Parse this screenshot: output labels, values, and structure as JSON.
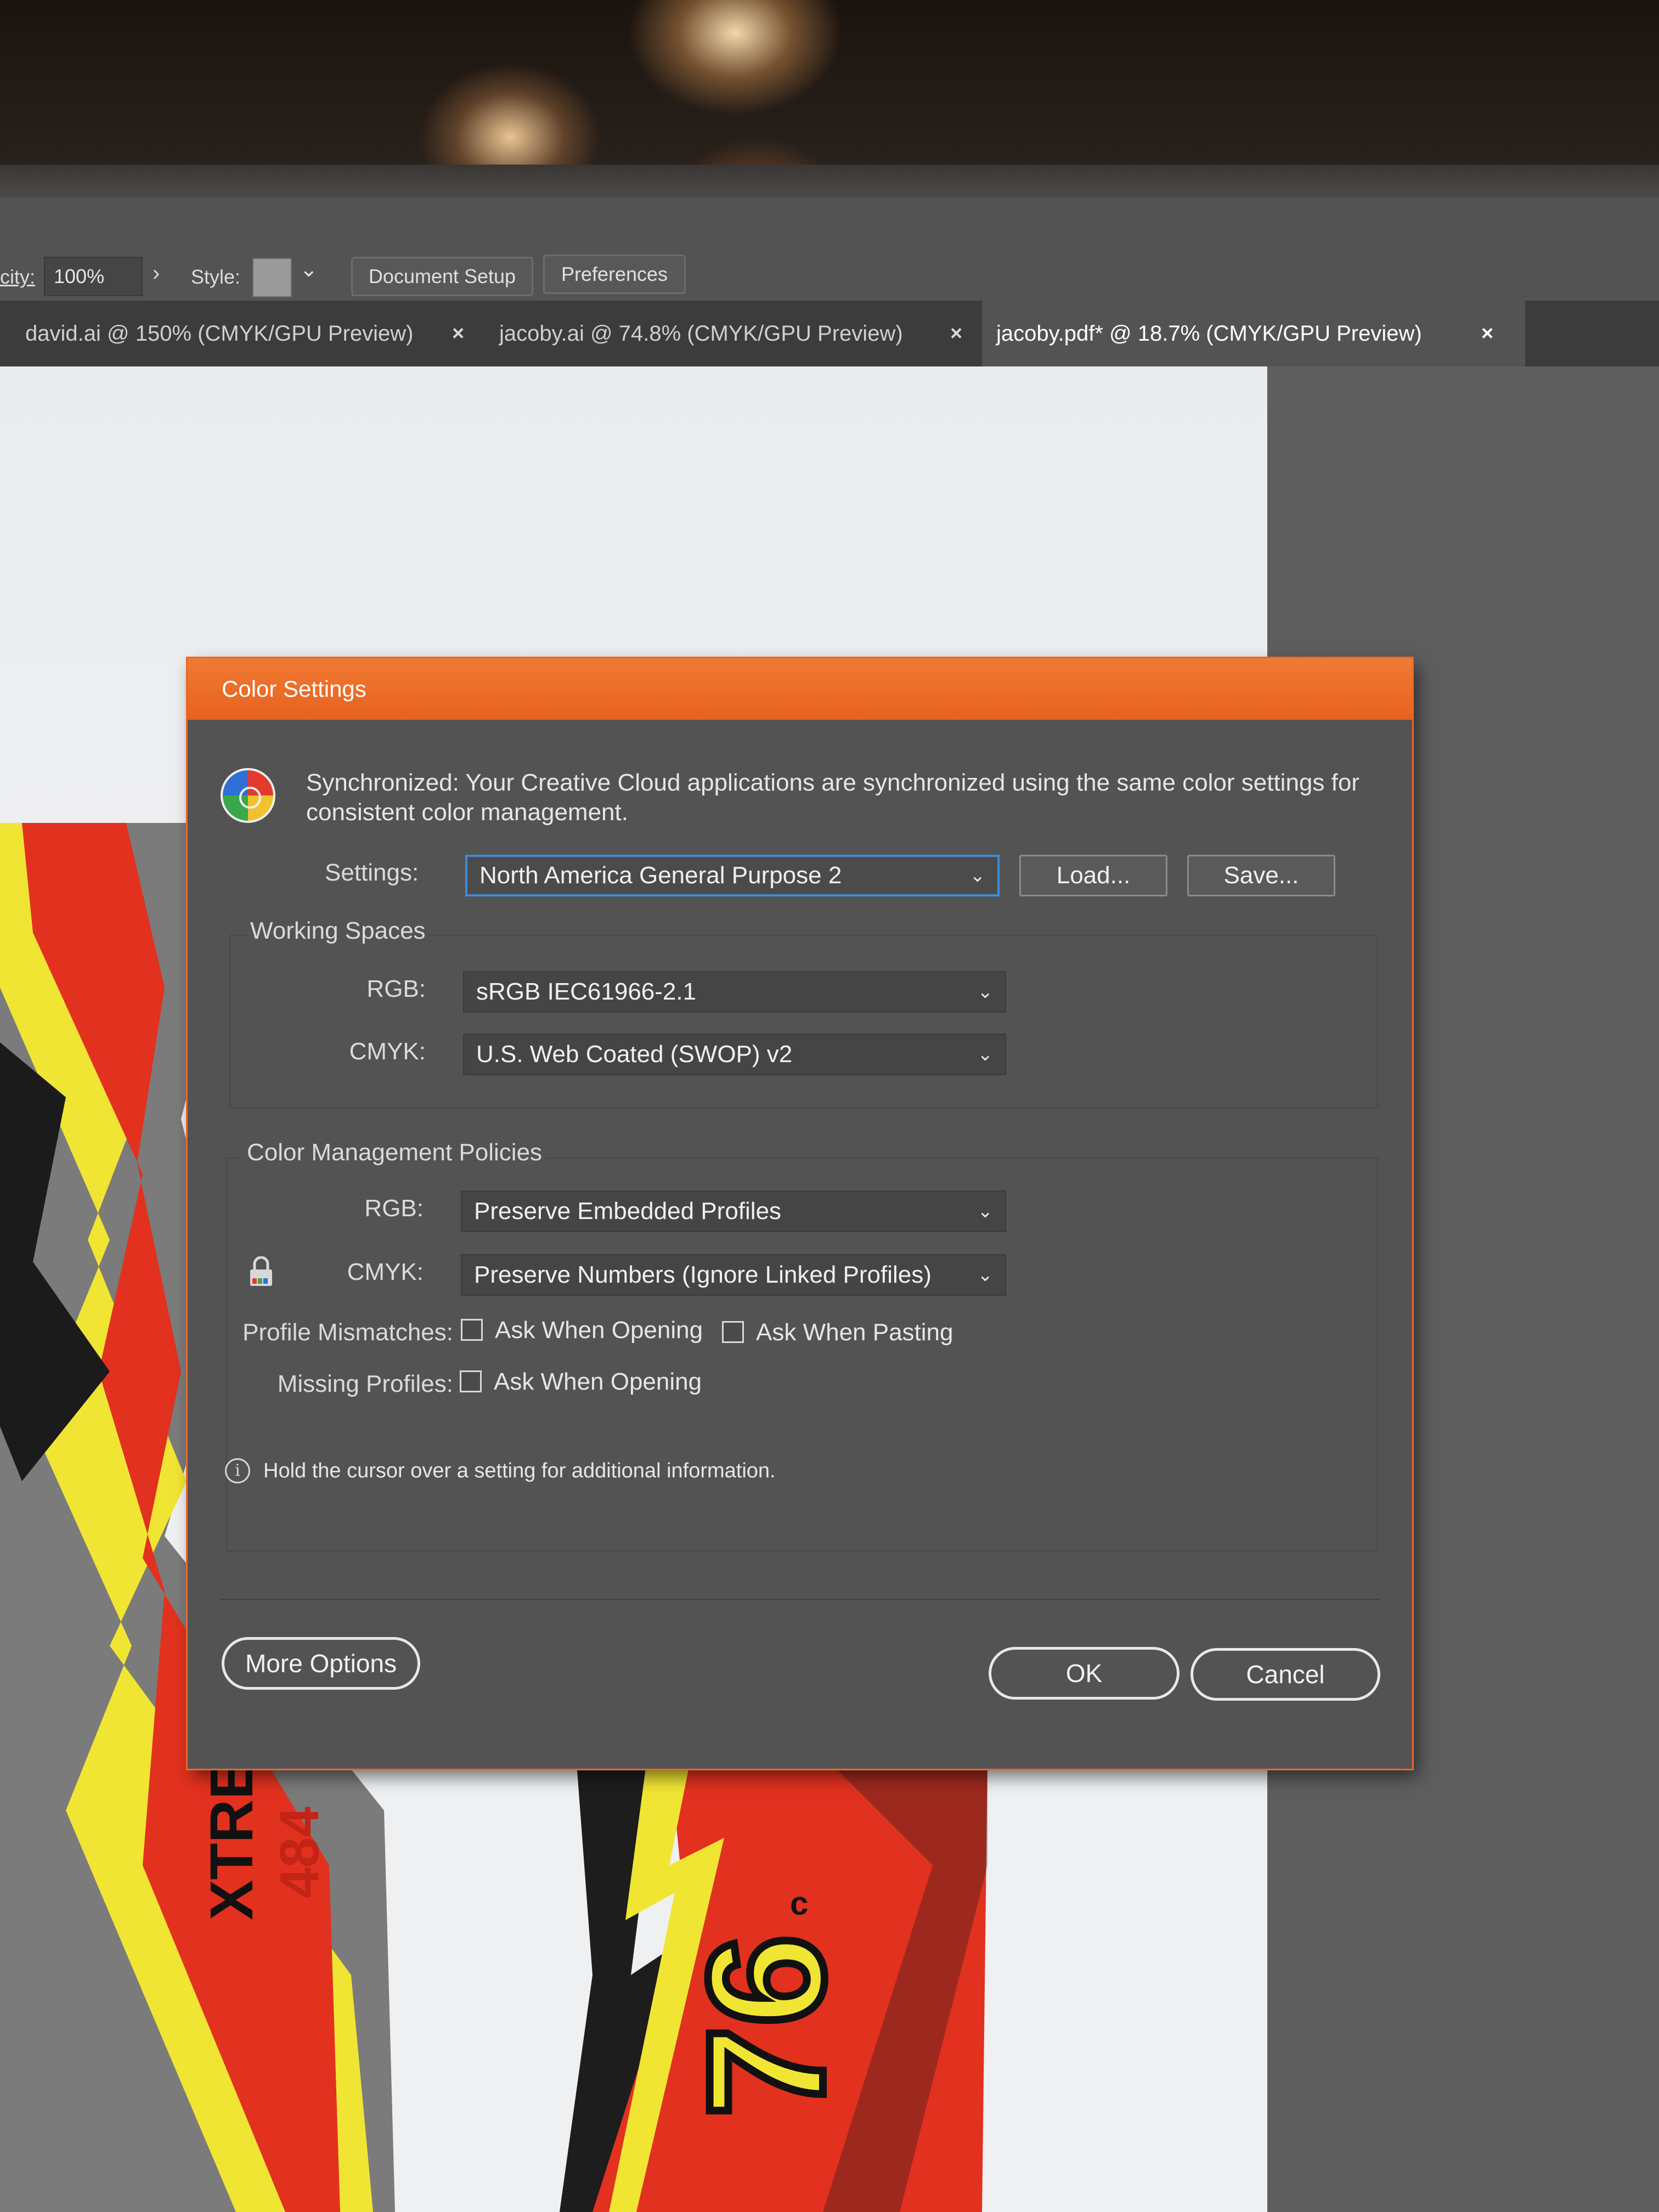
{
  "control_bar": {
    "opacity_label": "city:",
    "opacity_value": "100%",
    "style_label": "Style:",
    "document_setup_label": "Document Setup",
    "preferences_label": "Preferences"
  },
  "tabs": [
    {
      "label": "david.ai @ 150% (CMYK/GPU Preview)",
      "close": "×",
      "active": false
    },
    {
      "label": "jacoby.ai @ 74.8% (CMYK/GPU Preview)",
      "close": "×",
      "active": false
    },
    {
      "label": "jacoby.pdf* @ 18.7% (CMYK/GPU Preview)",
      "close": "×",
      "active": true
    }
  ],
  "artwork": {
    "left_text": "XTRE",
    "left_number": "484",
    "right_number": "76",
    "right_sup": "c"
  },
  "dialog": {
    "title": "Color Settings",
    "sync_message_line1": "Synchronized: Your Creative Cloud applications are synchronized using the same color settings for",
    "sync_message_line2": "consistent color management.",
    "settings_label": "Settings:",
    "settings_value": "North America General Purpose 2",
    "load_button": "Load...",
    "save_button": "Save...",
    "working_spaces": {
      "title": "Working Spaces",
      "rgb_label": "RGB:",
      "rgb_value": "sRGB IEC61966-2.1",
      "cmyk_label": "CMYK:",
      "cmyk_value": "U.S. Web Coated (SWOP) v2"
    },
    "policies": {
      "title": "Color Management Policies",
      "rgb_label": "RGB:",
      "rgb_value": "Preserve Embedded Profiles",
      "cmyk_label": "CMYK:",
      "cmyk_value": "Preserve Numbers (Ignore Linked Profiles)",
      "profile_mismatches_label": "Profile Mismatches:",
      "ask_when_opening_1": "Ask When Opening",
      "ask_when_pasting": "Ask When Pasting",
      "missing_profiles_label": "Missing Profiles:",
      "ask_when_opening_2": "Ask When Opening"
    },
    "info_text": "Hold the cursor over a setting for additional information.",
    "more_options_button": "More Options",
    "ok_button": "OK",
    "cancel_button": "Cancel"
  },
  "colors": {
    "title_bar": "#e6621f",
    "dialog_bg": "#535353",
    "focus_border": "#3e8bd8"
  }
}
